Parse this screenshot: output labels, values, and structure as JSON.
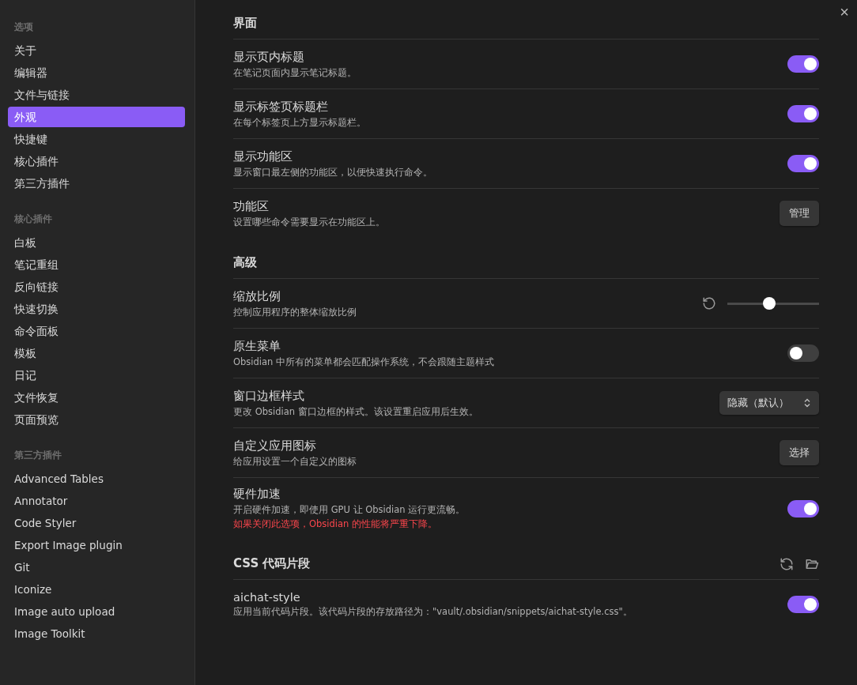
{
  "close_label": "×",
  "sidebar": [
    {
      "heading": "选项",
      "items": [
        {
          "label": "关于",
          "selected": false
        },
        {
          "label": "编辑器",
          "selected": false
        },
        {
          "label": "文件与链接",
          "selected": false
        },
        {
          "label": "外观",
          "selected": true
        },
        {
          "label": "快捷键",
          "selected": false
        },
        {
          "label": "核心插件",
          "selected": false
        },
        {
          "label": "第三方插件",
          "selected": false
        }
      ]
    },
    {
      "heading": "核心插件",
      "items": [
        {
          "label": "白板",
          "selected": false
        },
        {
          "label": "笔记重组",
          "selected": false
        },
        {
          "label": "反向链接",
          "selected": false
        },
        {
          "label": "快速切换",
          "selected": false
        },
        {
          "label": "命令面板",
          "selected": false
        },
        {
          "label": "模板",
          "selected": false
        },
        {
          "label": "日记",
          "selected": false
        },
        {
          "label": "文件恢复",
          "selected": false
        },
        {
          "label": "页面预览",
          "selected": false
        }
      ]
    },
    {
      "heading": "第三方插件",
      "items": [
        {
          "label": "Advanced Tables",
          "selected": false
        },
        {
          "label": "Annotator",
          "selected": false
        },
        {
          "label": "Code Styler",
          "selected": false
        },
        {
          "label": "Export Image plugin",
          "selected": false
        },
        {
          "label": "Git",
          "selected": false
        },
        {
          "label": "Iconize",
          "selected": false
        },
        {
          "label": "Image auto upload",
          "selected": false
        },
        {
          "label": "Image Toolkit",
          "selected": false
        }
      ]
    }
  ],
  "sections": [
    {
      "title": "界面",
      "header_icons": false,
      "settings": [
        {
          "kind": "toggle",
          "name": "显示页内标题",
          "description": "在笔记页面内显示笔记标题。",
          "on": true
        },
        {
          "kind": "toggle",
          "name": "显示标签页标题栏",
          "description": "在每个标签页上方显示标题栏。",
          "on": true
        },
        {
          "kind": "toggle",
          "name": "显示功能区",
          "description": "显示窗口最左侧的功能区，以便快速执行命令。",
          "on": true
        },
        {
          "kind": "button",
          "name": "功能区",
          "description": "设置哪些命令需要显示在功能区上。",
          "button": "管理"
        }
      ]
    },
    {
      "title": "高级",
      "header_icons": false,
      "settings": [
        {
          "kind": "slider",
          "name": "缩放比例",
          "description": "控制应用程序的整体缩放比例",
          "level": 0.46
        },
        {
          "kind": "toggle",
          "name": "原生菜单",
          "description": "Obsidian 中所有的菜单都会匹配操作系统，不会跟随主题样式",
          "on": false
        },
        {
          "kind": "dropdown",
          "name": "窗口边框样式",
          "description": "更改 Obsidian 窗口边框的样式。该设置重启应用后生效。",
          "value": "隐藏（默认）"
        },
        {
          "kind": "button",
          "name": "自定义应用图标",
          "description": "给应用设置一个自定义的图标",
          "button": "选择"
        },
        {
          "kind": "toggle",
          "name": "硬件加速",
          "description": "开启硬件加速，即使用 GPU 让 Obsidian 运行更流畅。",
          "warning": "如果关闭此选项，Obsidian 的性能将严重下降。",
          "on": true
        }
      ]
    },
    {
      "title": "CSS 代码片段",
      "header_icons": true,
      "settings": [
        {
          "kind": "toggle",
          "name": "aichat-style",
          "description": "应用当前代码片段。该代码片段的存放路径为：\"vault/.obsidian/snippets/aichat-style.css\"。",
          "on": true
        }
      ]
    }
  ]
}
